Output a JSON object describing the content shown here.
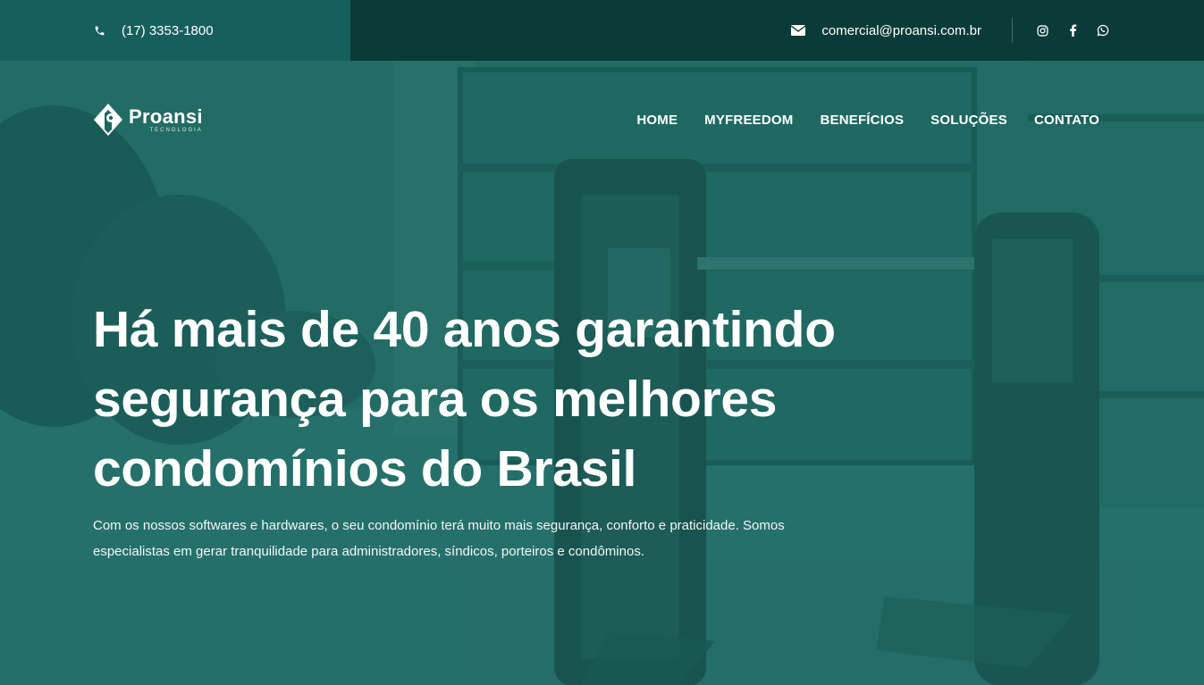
{
  "topbar": {
    "phone": "(17) 3353-1800",
    "email": "comercial@proansi.com.br",
    "social": [
      "instagram-icon",
      "facebook-icon",
      "whatsapp-icon"
    ]
  },
  "header": {
    "logo_name": "Proansi",
    "logo_sub": "TECNOLOGIA",
    "menu": [
      "HOME",
      "MYFREEDOM",
      "BENEFÍCIOS",
      "SOLUÇÕES",
      "CONTATO"
    ]
  },
  "hero": {
    "headline_1": "Há mais de 40 anos garantindo",
    "headline_2": "segurança para os melhores",
    "headline_3": "condomínios do Brasil",
    "paragraph_1": "Com os nossos softwares e hardwares, o seu condomínio terá muito mais segurança, conforto e praticidade. Somos",
    "paragraph_2": "especialistas em gerar tranquilidade para administradores, síndicos, porteiros e condôminos."
  },
  "colors": {
    "topbar_left": "#175f5d",
    "topbar_right": "#0a3b38",
    "hero_tint": "#1f6660"
  }
}
